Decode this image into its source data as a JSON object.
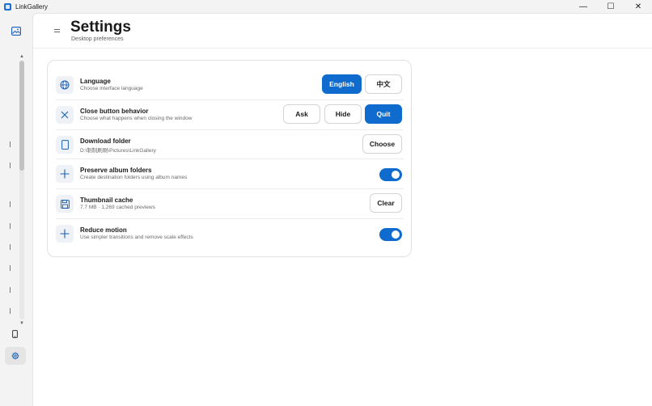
{
  "window": {
    "title": "LinkGallery",
    "controls": {
      "minimize": "—",
      "maximize": "☐",
      "close": "✕"
    }
  },
  "sidebar": {
    "scroll_up": "▲",
    "scroll_down": "▼",
    "items": [
      {
        "icon": "image-icon"
      },
      {
        "icon": "phone-icon"
      },
      {
        "icon": "gear-icon",
        "selected": true
      }
    ]
  },
  "header": {
    "menu_icon": "menu-icon",
    "title": "Settings",
    "subtitle": "Desktop preferences"
  },
  "settings": {
    "language": {
      "title": "Language",
      "subtitle": "Choose interface language",
      "icon": "globe-icon",
      "options": [
        "English",
        "中文"
      ],
      "selected": "English"
    },
    "close_behavior": {
      "title": "Close button behavior",
      "subtitle": "Choose what happens when closing the window",
      "icon": "close-icon",
      "options": [
        "Ask",
        "Hide",
        "Quit"
      ],
      "selected": "Quit"
    },
    "download_folder": {
      "title": "Download folder",
      "subtitle": "D:\\制制刷刷\\Pictures\\LinkGallery",
      "icon": "folder-icon",
      "button": "Choose"
    },
    "preserve_album": {
      "title": "Preserve album folders",
      "subtitle": "Create destination folders using album names",
      "icon": "plus-icon",
      "enabled": true
    },
    "thumbnail_cache": {
      "title": "Thumbnail cache",
      "subtitle": "7.7 MB · 1,269 cached previews",
      "icon": "save-icon",
      "button": "Clear"
    },
    "reduce_motion": {
      "title": "Reduce motion",
      "subtitle": "Use simpler transitions and remove scale effects",
      "icon": "plus-icon",
      "enabled": true
    }
  },
  "colors": {
    "accent": "#0f6cce",
    "icon_bg": "#eef1f6",
    "window_bg": "#f3f3f3"
  }
}
